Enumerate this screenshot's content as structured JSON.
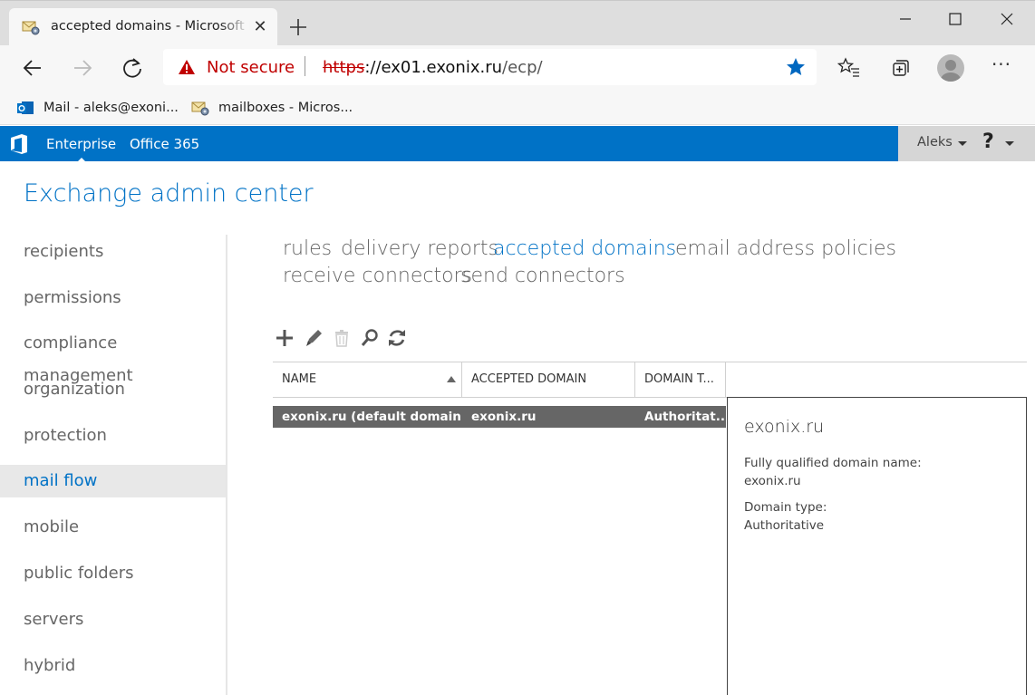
{
  "browser": {
    "tab": {
      "title": "accepted domains - Microsoft Exchange"
    },
    "address": {
      "warning": "Not secure",
      "scheme": "https",
      "url_rest_host": "://ex01.exonix.ru",
      "url_path": "/ecp/"
    },
    "favorites": [
      {
        "label": "Mail - aleks@exoni..."
      },
      {
        "label": "mailboxes - Micros..."
      }
    ]
  },
  "ecp": {
    "topnav": {
      "enterprise": "Enterprise",
      "office365": "Office 365"
    },
    "user": "Aleks",
    "help": "?",
    "title": "Exchange admin center",
    "left_nav": [
      {
        "label": "recipients"
      },
      {
        "label": "permissions"
      },
      {
        "label": "compliance management"
      },
      {
        "label": "organization"
      },
      {
        "label": "protection"
      },
      {
        "label": "mail flow"
      },
      {
        "label": "mobile"
      },
      {
        "label": "public folders"
      },
      {
        "label": "servers"
      },
      {
        "label": "hybrid"
      }
    ],
    "left_nav_selected": "mail flow",
    "sub_nav": [
      {
        "label": "rules"
      },
      {
        "label": "delivery reports"
      },
      {
        "label": "accepted domains"
      },
      {
        "label": "email address policies"
      },
      {
        "label": "receive connectors"
      },
      {
        "label": "send connectors"
      }
    ],
    "sub_nav_active": "accepted domains",
    "toolbar": [
      "add-icon",
      "edit-icon",
      "delete-icon",
      "search-icon",
      "refresh-icon"
    ],
    "grid": {
      "columns": [
        "NAME",
        "ACCEPTED DOMAIN",
        "DOMAIN T..."
      ],
      "rows": [
        {
          "name": "exonix.ru (default domain)",
          "domain": "exonix.ru",
          "type": "Authoritat..."
        }
      ]
    },
    "details": {
      "title": "exonix.ru",
      "fqdn_label": "Fully qualified domain name:",
      "fqdn_value": "exonix.ru",
      "type_label": "Domain type:",
      "type_value": "Authoritative"
    }
  },
  "colors": {
    "accent": "#0072c6",
    "selected_row": "#666666",
    "warning": "#c00000"
  }
}
